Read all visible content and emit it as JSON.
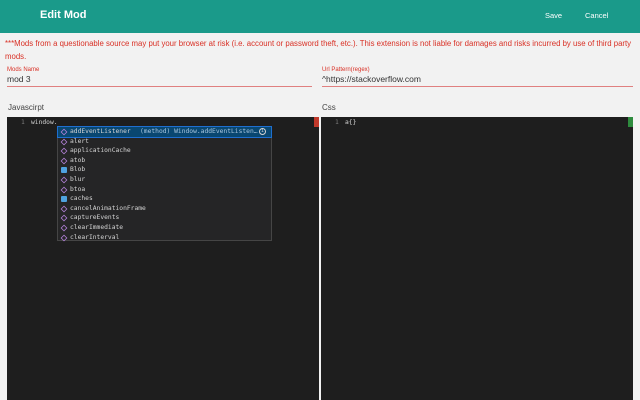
{
  "header": {
    "title": "Edit Mod",
    "save_label": "Save",
    "cancel_label": "Cancel"
  },
  "warning": "***Mods from a questionable source may put your browser at risk (i.e. account or password theft, etc.). This extension is not liable for damages and risks incurred by use of third party mods.",
  "form": {
    "name_label": "Mods Name",
    "name_value": "mod 3",
    "url_label": "Url Pattern(regex)",
    "url_value": "^https://stackoverflow.com"
  },
  "editors": {
    "js_label": "Javascirpt",
    "css_label": "Css",
    "js_line_number": "1",
    "js_code": "window.",
    "css_line_number": "1",
    "css_code": "a{}"
  },
  "suggestions": {
    "selected_detail": "(method) Window.addEventListen…",
    "items": [
      {
        "label": "addEventListener",
        "kind": "method"
      },
      {
        "label": "alert",
        "kind": "method"
      },
      {
        "label": "applicationCache",
        "kind": "method"
      },
      {
        "label": "atob",
        "kind": "method"
      },
      {
        "label": "Blob",
        "kind": "property"
      },
      {
        "label": "blur",
        "kind": "method"
      },
      {
        "label": "btoa",
        "kind": "method"
      },
      {
        "label": "caches",
        "kind": "property"
      },
      {
        "label": "cancelAnimationFrame",
        "kind": "method"
      },
      {
        "label": "captureEvents",
        "kind": "method"
      },
      {
        "label": "clearImmediate",
        "kind": "method"
      },
      {
        "label": "clearInterval",
        "kind": "method"
      }
    ]
  }
}
